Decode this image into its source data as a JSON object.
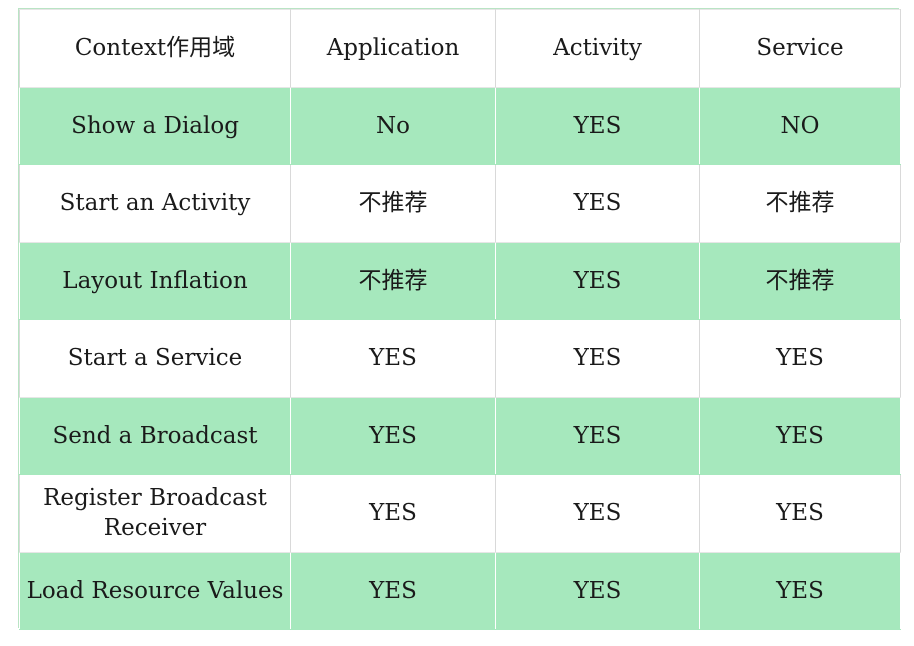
{
  "table": {
    "header": [
      "Context作用域",
      "Application",
      "Activity",
      "Service"
    ],
    "rows": [
      [
        "Show a Dialog",
        "No",
        "YES",
        "NO"
      ],
      [
        "Start an Activity",
        "不推荐",
        "YES",
        "不推荐"
      ],
      [
        "Layout Inflation",
        "不推荐",
        "YES",
        "不推荐"
      ],
      [
        "Start a Service",
        "YES",
        "YES",
        "YES"
      ],
      [
        "Send a Broadcast",
        "YES",
        "YES",
        "YES"
      ],
      [
        "Register Broadcast Receiver",
        "YES",
        "YES",
        "YES"
      ],
      [
        "Load Resource Values",
        "YES",
        "YES",
        "YES"
      ]
    ]
  },
  "colors": {
    "row_green": "#a6e8bd",
    "row_white": "#ffffff",
    "border": "#b9e4c4"
  }
}
